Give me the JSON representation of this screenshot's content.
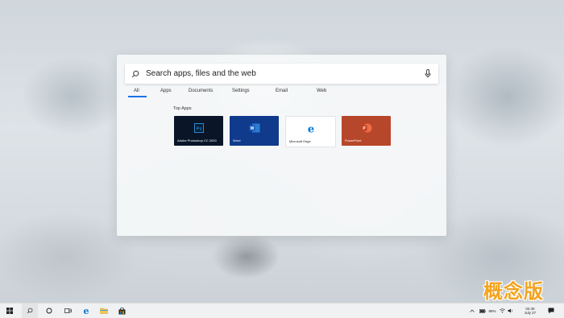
{
  "search": {
    "placeholder": "Search apps, files and the web"
  },
  "tabs": [
    {
      "label": "All",
      "active": true
    },
    {
      "label": "Apps"
    },
    {
      "label": "Documents"
    },
    {
      "label": "Settings"
    },
    {
      "label": "Email"
    },
    {
      "label": "Web"
    }
  ],
  "section": {
    "title": "Top Apps"
  },
  "apps": [
    {
      "label": "Adobe Photoshop CC 2020",
      "icon": "photoshop-icon",
      "glyph": "Ps",
      "bg": "#0a1628",
      "accent": "#31a8ff"
    },
    {
      "label": "Word",
      "icon": "word-icon",
      "glyph": "W",
      "bg": "#103a8c",
      "accent": "#2b7cd3"
    },
    {
      "label": "Microsoft Edge",
      "icon": "edge-icon",
      "glyph": "e",
      "bg": "#ffffff",
      "accent": "#0078d7"
    },
    {
      "label": "PowerPoint",
      "icon": "powerpoint-icon",
      "glyph": "P",
      "bg": "#b7472a",
      "accent": "#d35230"
    }
  ],
  "watermark": {
    "text": "概念版"
  },
  "taskbar": {
    "battery": "86%",
    "time": "02:45",
    "date": "July 27"
  }
}
